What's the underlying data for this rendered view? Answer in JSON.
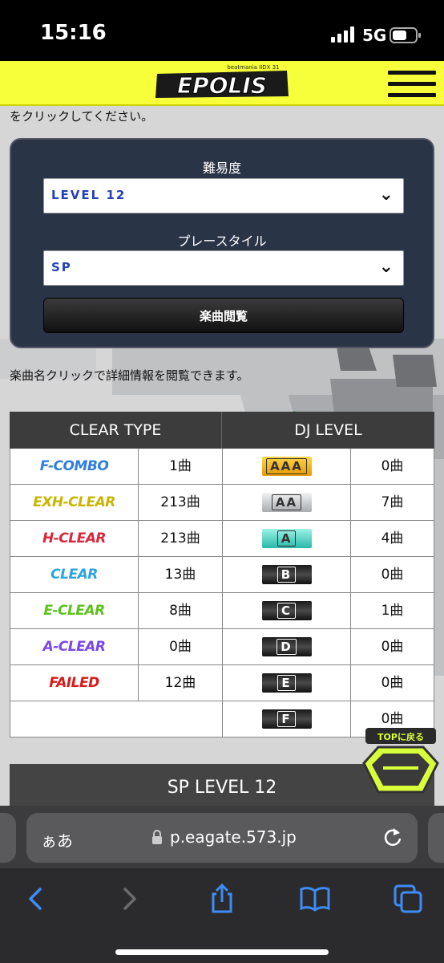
{
  "status_bar": {
    "time": "15:16",
    "network": "5G"
  },
  "header": {
    "logo_text": "EPOLIS",
    "logo_subtitle": "beatmania IIDX 31"
  },
  "intro_text": "をクリックしてください。",
  "filter": {
    "difficulty_label": "難易度",
    "difficulty_value": "LEVEL 12",
    "style_label": "プレースタイル",
    "style_value": "SP",
    "browse_button": "楽曲閲覧"
  },
  "note_text": "楽曲名クリックで詳細情報を閲覧できます。",
  "stats": {
    "clear_header": "CLEAR TYPE",
    "dj_header": "DJ LEVEL",
    "clear_rows": [
      {
        "label": "F-COMBO",
        "count": "1曲"
      },
      {
        "label": "EXH-CLEAR",
        "count": "213曲"
      },
      {
        "label": "H-CLEAR",
        "count": "213曲"
      },
      {
        "label": "CLEAR",
        "count": "13曲"
      },
      {
        "label": "E-CLEAR",
        "count": "8曲"
      },
      {
        "label": "A-CLEAR",
        "count": "0曲"
      },
      {
        "label": "FAILED",
        "count": "12曲"
      }
    ],
    "dj_rows": [
      {
        "label": "AAA",
        "count": "0曲"
      },
      {
        "label": "AA",
        "count": "7曲"
      },
      {
        "label": "A",
        "count": "4曲"
      },
      {
        "label": "B",
        "count": "0曲"
      },
      {
        "label": "C",
        "count": "1曲"
      },
      {
        "label": "D",
        "count": "0曲"
      },
      {
        "label": "E",
        "count": "0曲"
      },
      {
        "label": "F",
        "count": "0曲"
      }
    ]
  },
  "section_title": "SP LEVEL 12",
  "top_button": {
    "label": "TOPに戻る"
  },
  "browser": {
    "text_size_label": "ぁあ",
    "url": "p.eagate.573.jp"
  },
  "colors": {
    "header_yellow": "#f6ff3a",
    "panel_navy": "#2a3447",
    "select_text": "#2340b5",
    "f_combo": "#2f7de0",
    "exh_clear": "#c9b400",
    "h_clear": "#d8263a",
    "clear": "#2aa3e0",
    "e_clear": "#5bc21c",
    "a_clear": "#7a46e6",
    "failed": "#d81b1b",
    "aaa_badge": "#f5b400",
    "aa_badge": "#cfd2d6",
    "a_badge": "#44d3c2"
  },
  "icons": [
    "signal-icon",
    "battery-icon",
    "menu-icon",
    "chevron-down-icon",
    "lock-icon",
    "reload-icon",
    "back-icon",
    "forward-icon",
    "share-icon",
    "bookmarks-icon",
    "tabs-icon"
  ]
}
